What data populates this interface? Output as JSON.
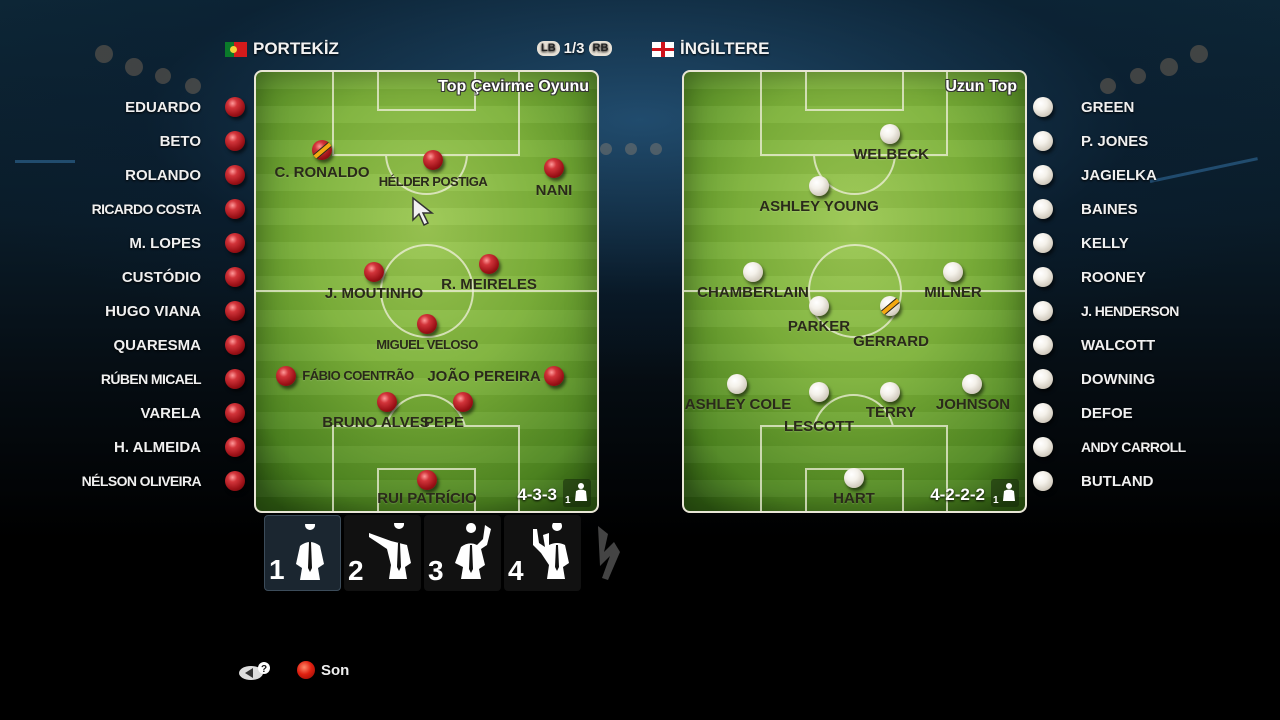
{
  "header": {
    "home_team": "PORTEKİZ",
    "home_flag": "portugal-flag-icon",
    "away_team": "İNGİLTERE",
    "away_flag": "england-flag-icon",
    "pager": {
      "prev_button": "LB",
      "page": "1/3",
      "next_button": "RB"
    }
  },
  "colors": {
    "home_ball": "#b3181f",
    "away_ball": "#f2efe8",
    "captain_band": "#f4a811",
    "pitch": "#7db23a"
  },
  "home": {
    "tactic": "Top Çevirme Oyunu",
    "formation": "4-3-3",
    "manager_slot": "1",
    "subs": [
      "EDUARDO",
      "BETO",
      "ROLANDO",
      "RICARDO COSTA",
      "M. LOPES",
      "CUSTÓDIO",
      "HUGO VIANA",
      "QUARESMA",
      "RÚBEN MICAEL",
      "VARELA",
      "H. ALMEIDA",
      "NÉLSON OLIVEIRA"
    ],
    "lineup": [
      {
        "name": "C. RONALDO",
        "captain": true
      },
      {
        "name": "HÉLDER POSTIGA",
        "captain": false
      },
      {
        "name": "NANI",
        "captain": false
      },
      {
        "name": "J. MOUTINHO",
        "captain": false
      },
      {
        "name": "R. MEIRELES",
        "captain": false
      },
      {
        "name": "MIGUEL VELOSO",
        "captain": false
      },
      {
        "name": "FÁBIO COENTRÃO",
        "captain": false
      },
      {
        "name": "JOÃO PEREIRA",
        "captain": false
      },
      {
        "name": "BRUNO ALVES",
        "captain": false
      },
      {
        "name": "PEPE",
        "captain": false
      },
      {
        "name": "RUI PATRÍCIO",
        "captain": false
      }
    ]
  },
  "away": {
    "tactic": "Uzun Top",
    "formation": "4-2-2-2",
    "manager_slot": "1",
    "subs": [
      "GREEN",
      "P. JONES",
      "JAGIELKA",
      "BAINES",
      "KELLY",
      "ROONEY",
      "J. HENDERSON",
      "WALCOTT",
      "DOWNING",
      "DEFOE",
      "ANDY CARROLL",
      "BUTLAND"
    ],
    "lineup": [
      {
        "name": "WELBECK",
        "captain": false
      },
      {
        "name": "ASHLEY YOUNG",
        "captain": false
      },
      {
        "name": "CHAMBERLAIN",
        "captain": false
      },
      {
        "name": "MILNER",
        "captain": false
      },
      {
        "name": "PARKER",
        "captain": false
      },
      {
        "name": "GERRARD",
        "captain": true
      },
      {
        "name": "ASHLEY COLE",
        "captain": false
      },
      {
        "name": "LESCOTT",
        "captain": false
      },
      {
        "name": "TERRY",
        "captain": false
      },
      {
        "name": "JOHNSON",
        "captain": false
      },
      {
        "name": "HART",
        "captain": false
      }
    ]
  },
  "manager_tabs": [
    {
      "number": "1",
      "icon": "manager-arms-akimbo-icon"
    },
    {
      "number": "2",
      "icon": "manager-pointing-icon"
    },
    {
      "number": "3",
      "icon": "manager-raised-arm-icon"
    },
    {
      "number": "4",
      "icon": "manager-gesturing-icon"
    }
  ],
  "footer": {
    "help_icon": "back-help-icon",
    "son_label": "Son"
  }
}
